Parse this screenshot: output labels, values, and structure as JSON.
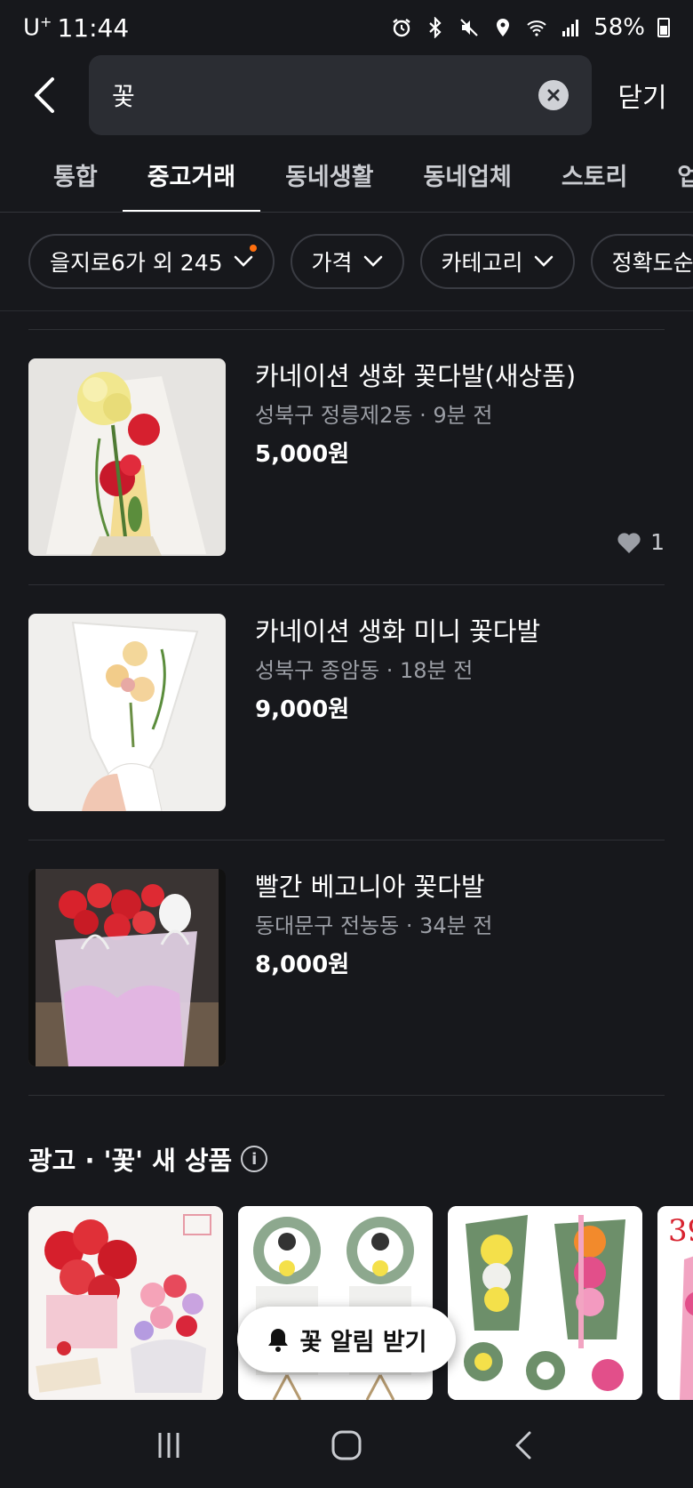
{
  "status_bar": {
    "carrier": "U",
    "carrier_sup": "+",
    "time": "11:44",
    "battery": "58%",
    "icons": [
      "alarm-icon",
      "bluetooth-icon",
      "mute-icon",
      "location-icon",
      "wifi-icon",
      "signal-icon",
      "battery-icon"
    ]
  },
  "search": {
    "query": "꽃",
    "close_label": "닫기"
  },
  "tabs": [
    {
      "label": "통합",
      "active": false
    },
    {
      "label": "중고거래",
      "active": true
    },
    {
      "label": "동네생활",
      "active": false
    },
    {
      "label": "동네업체",
      "active": false
    },
    {
      "label": "스토리",
      "active": false
    },
    {
      "label": "업체",
      "active": false
    }
  ],
  "filters": [
    {
      "label": "을지로6가 외 245",
      "has_dot": true
    },
    {
      "label": "가격"
    },
    {
      "label": "카테고리"
    },
    {
      "label": "정확도순"
    }
  ],
  "listings": [
    {
      "title": "카네이션 생화 꽃다발(새상품)",
      "location": "성북구 정릉제2동",
      "time": "9분 전",
      "meta": "성북구 정릉제2동 · 9분 전",
      "price": "5,000원",
      "likes": "1"
    },
    {
      "title": "카네이션 생화 미니 꽃다발",
      "location": "성북구 종암동",
      "time": "18분 전",
      "meta": "성북구 종암동 · 18분 전",
      "price": "9,000원"
    },
    {
      "title": "빨간 베고니아 꽃다발",
      "location": "동대문구 전농동",
      "time": "34분 전",
      "meta": "동대문구 전농동 · 34분 전",
      "price": "8,000원"
    }
  ],
  "ad_section": {
    "title": "광고 · '꽃' 새 상품",
    "info_icon": "info-icon",
    "partial_card_text": "39"
  },
  "alarm_button": {
    "label": "꽃 알림 받기",
    "icon": "bell-icon"
  },
  "nav": [
    "recent-apps-icon",
    "home-icon",
    "back-icon"
  ],
  "colors": {
    "background": "#17181c",
    "search_box": "#2b2d33",
    "accent_dot": "#ff6f0f",
    "meta_text": "#9b9ea5"
  }
}
